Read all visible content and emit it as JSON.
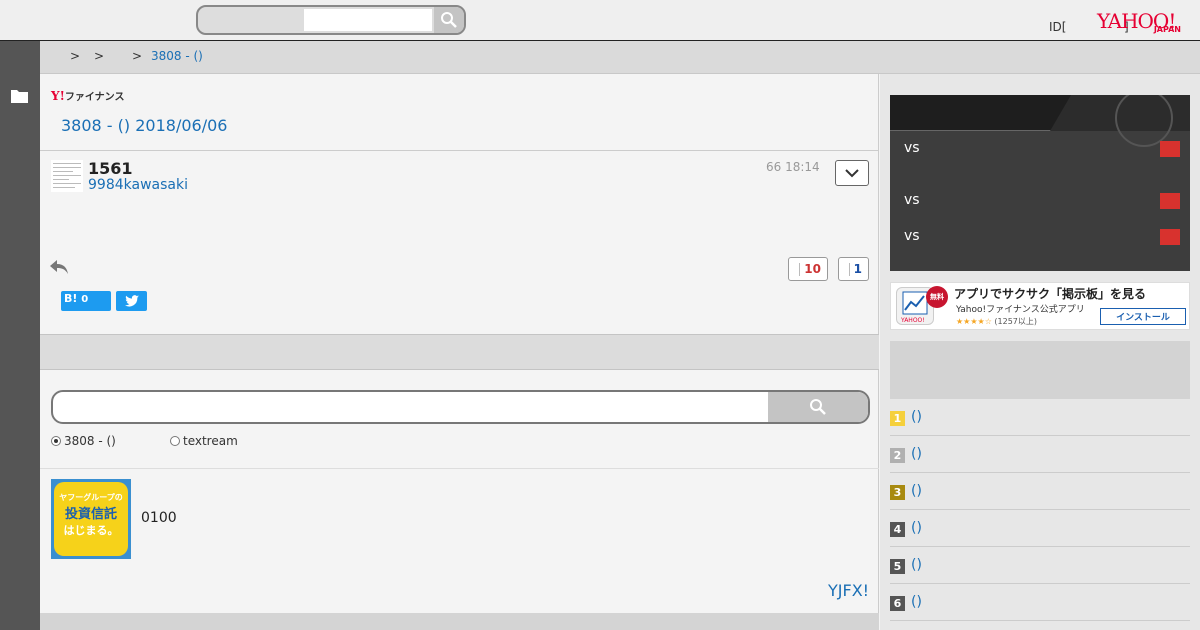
{
  "header": {
    "id_text": "ID[",
    "bracket_text": "]",
    "logo_text": "YAHOO!",
    "logo_sub": "JAPAN"
  },
  "breadcrumb": {
    "items": [
      ">",
      ">",
      ">"
    ],
    "current": "3808 - ()"
  },
  "board": {
    "finance_logo_y": "Y!",
    "finance_logo_text": "ファイナンス",
    "title": "3808 - () 2018/06/06"
  },
  "post": {
    "number": "1561",
    "user": "9984kawasaki",
    "time": "66 18:14",
    "like_count": "10",
    "dislike_count": "1",
    "hatena_label": "B!",
    "hatena_count": "0"
  },
  "search": {
    "radio_options": [
      {
        "label": "3808 - ()",
        "selected": true
      },
      {
        "label": "textream",
        "selected": false
      }
    ]
  },
  "ad": {
    "banner_line1": "ヤフーグループの",
    "banner_line2": "投資信託",
    "banner_line3": "はじまる。",
    "text": "0100",
    "link_text": "YJFX!"
  },
  "sidebar": {
    "games": [
      {
        "label": "vs"
      },
      {
        "label": "vs"
      },
      {
        "label": "vs"
      }
    ],
    "app_ad": {
      "free_badge": "無料",
      "title": "アプリでサクサク「掲示板」を見る",
      "subtitle": "Yahoo!ファイナンス公式アプリ",
      "stars": "★★★★☆",
      "reviews": "(1257以上)",
      "install_label": "インストール",
      "icon_logo": "YAHOO!"
    },
    "ranking": [
      {
        "rank": "1",
        "label": "()",
        "color": "#f5d03c"
      },
      {
        "rank": "2",
        "label": "()",
        "color": "#b0b0b0"
      },
      {
        "rank": "3",
        "label": "()",
        "color": "#a88a10"
      },
      {
        "rank": "4",
        "label": "()",
        "color": "#555555"
      },
      {
        "rank": "5",
        "label": "()",
        "color": "#555555"
      },
      {
        "rank": "6",
        "label": "()",
        "color": "#555555"
      }
    ]
  },
  "colors": {
    "accent_blue": "#1a6fb5",
    "yahoo_red": "#e60033",
    "badge_red": "#d8322e"
  }
}
